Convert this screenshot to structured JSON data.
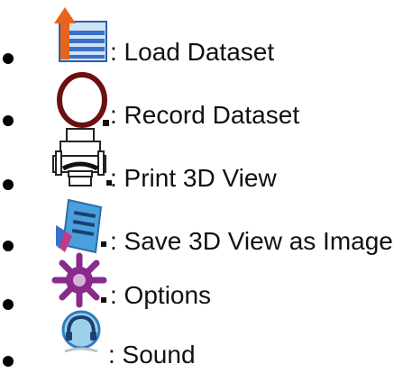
{
  "legend": {
    "items": [
      {
        "icon": "load-dataset-icon",
        "label": ": Load Dataset"
      },
      {
        "icon": "record-dataset-icon",
        "label": ": Record Dataset"
      },
      {
        "icon": "print-3d-view-icon",
        "label": ": Print 3D View"
      },
      {
        "icon": "save-3d-view-as-image-icon",
        "label": ": Save 3D View as Image"
      },
      {
        "icon": "options-gear-icon",
        "label": ": Options"
      },
      {
        "icon": "sound-icon",
        "label": ": Sound"
      }
    ]
  },
  "colors": {
    "text": "#111111",
    "load_arrow": "#e8641c",
    "load_doc": "#cfe3f4",
    "load_lines": "#3b6fc8",
    "record_circle": "#6b0f0f",
    "save_doc": "#4aa0dc",
    "save_arrow": "#c43a86",
    "gear": "#8a2a8a",
    "sound_ring": "#2b7fc0",
    "sound_face": "#9fd0ea"
  }
}
